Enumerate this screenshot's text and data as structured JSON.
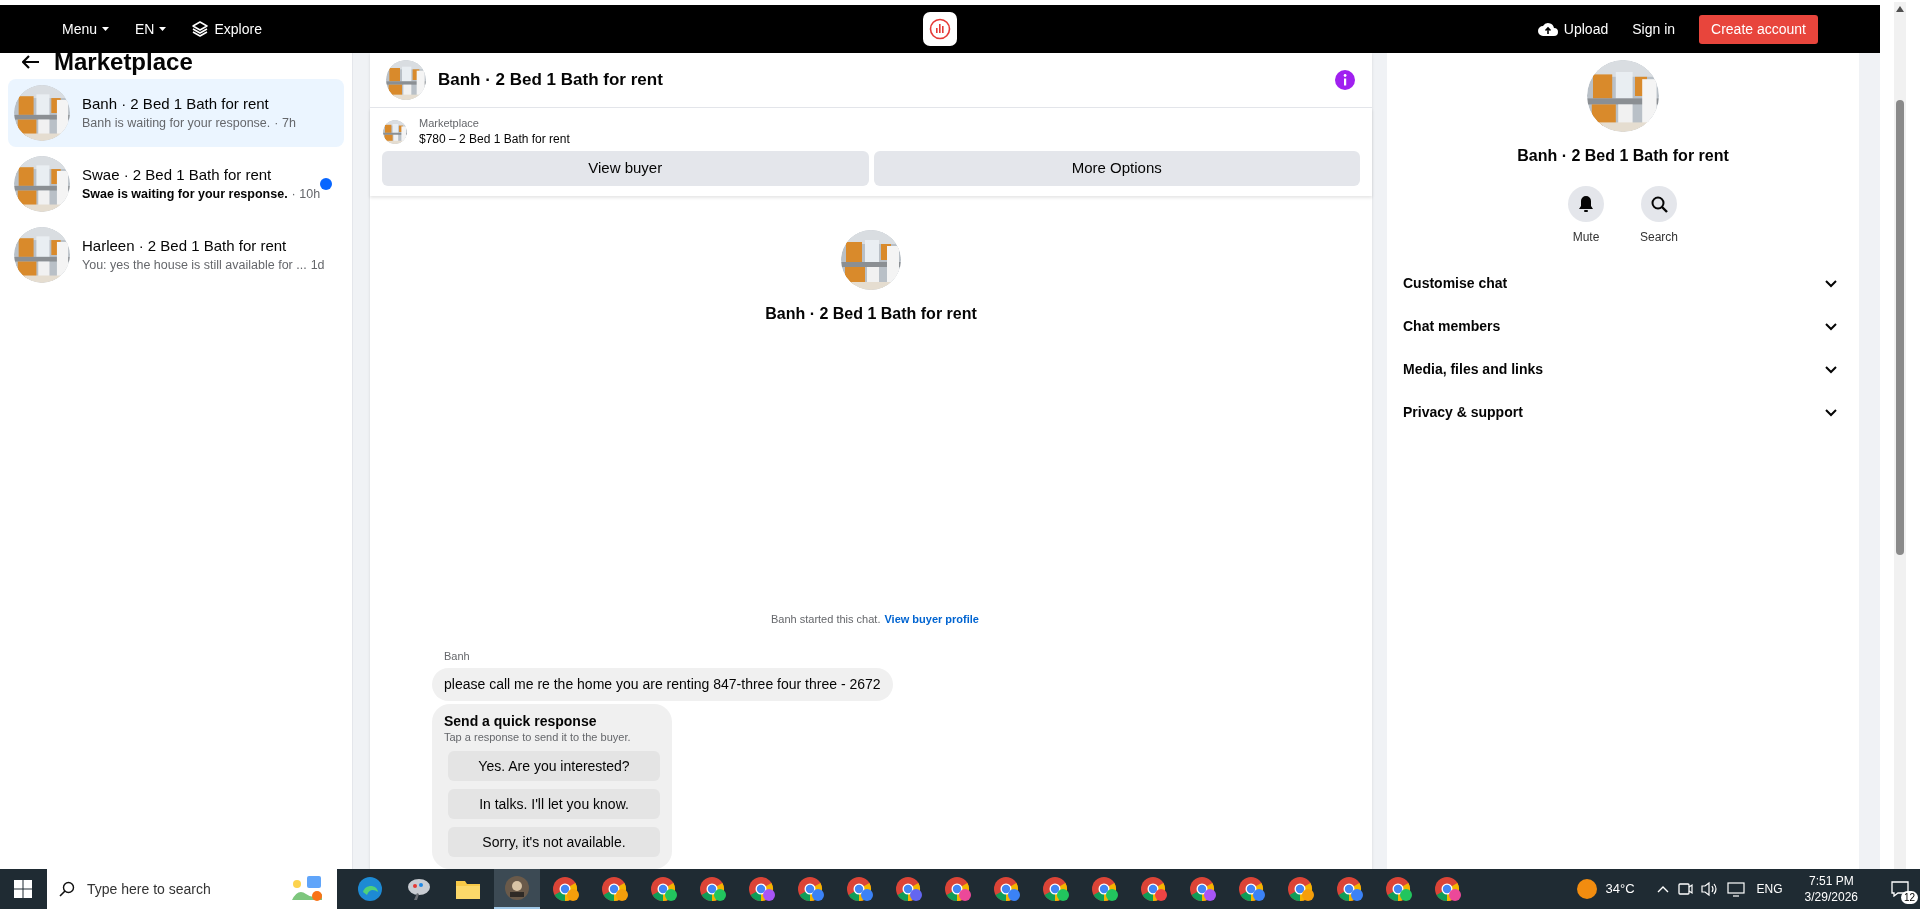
{
  "top_bar": {
    "menu": "Menu",
    "language": "EN",
    "explore": "Explore",
    "upload": "Upload",
    "sign_in": "Sign in",
    "create_account": "Create account"
  },
  "sidebar": {
    "title": "Marketplace",
    "conversations": [
      {
        "title": "Banh · 2 Bed 1 Bath for rent",
        "preview": "Banh is waiting for your response.",
        "time": "· 7h",
        "selected": true,
        "unread": false
      },
      {
        "title": "Swae · 2 Bed 1 Bath for rent",
        "preview": "Swae is waiting for your response.",
        "time": "· 10h",
        "selected": false,
        "unread": true
      },
      {
        "title": "Harleen · 2 Bed 1 Bath for rent",
        "preview": "You: yes the house is still available for ...",
        "time": "1d",
        "selected": false,
        "unread": false
      }
    ]
  },
  "chat": {
    "header_title": "Banh · 2 Bed 1 Bath for rent",
    "listing": {
      "label": "Marketplace",
      "title": "$780 – 2 Bed 1 Bath for rent"
    },
    "buttons": [
      "View buyer",
      "More Options"
    ],
    "intro_title": "Banh · 2 Bed 1 Bath for rent",
    "started_text": "Banh started this chat.",
    "started_link": "View buyer profile",
    "messages": [
      {
        "sender": "Banh",
        "text": "please call me re the home you are renting 847-three four three - 2672"
      }
    ],
    "quick_response": {
      "title": "Send a quick response",
      "subtitle": "Tap a response to send it to the buyer.",
      "options": [
        "Yes. Are you interested?",
        "In talks. I'll let you know.",
        "Sorry, it's not available."
      ]
    }
  },
  "details": {
    "title": "Banh · 2 Bed 1 Bath for rent",
    "actions": [
      {
        "kind": "mute",
        "label": "Mute"
      },
      {
        "kind": "search",
        "label": "Search"
      }
    ],
    "sections": [
      {
        "label": "Customise chat",
        "expanded": false
      },
      {
        "label": "Chat members",
        "expanded": false
      },
      {
        "label": "Media, files and links",
        "expanded": false
      },
      {
        "label": "Privacy & support",
        "expanded": false
      }
    ]
  },
  "taskbar": {
    "search_placeholder": "Type here to search",
    "apps": [
      {
        "kind": "edge"
      },
      {
        "kind": "tool"
      },
      {
        "kind": "folder"
      },
      {
        "kind": "app",
        "selected": true
      },
      {
        "kind": "chrome",
        "color": "#f59e0b"
      },
      {
        "kind": "chrome",
        "color": "#f59e0b"
      },
      {
        "kind": "chrome",
        "color": "#22c55e"
      },
      {
        "kind": "chrome",
        "color": "#22c55e"
      },
      {
        "kind": "chrome",
        "color": "#a855f7"
      },
      {
        "kind": "chrome",
        "color": "#3b82f6"
      },
      {
        "kind": "chrome",
        "color": "#3b82f6"
      },
      {
        "kind": "chrome",
        "color": "#6366f1"
      },
      {
        "kind": "chrome",
        "color": "#ec4899"
      },
      {
        "kind": "chrome",
        "color": "#3b82f6"
      },
      {
        "kind": "chrome",
        "color": "#22c55e"
      },
      {
        "kind": "chrome",
        "color": "#22c55e"
      },
      {
        "kind": "chrome",
        "color": "#ef4444"
      },
      {
        "kind": "chrome",
        "color": "#a855f7"
      },
      {
        "kind": "chrome",
        "color": "#3b82f6"
      },
      {
        "kind": "chrome",
        "color": "#f59e0b"
      },
      {
        "kind": "chrome",
        "color": "#3b82f6"
      },
      {
        "kind": "chrome",
        "color": "#22c55e"
      },
      {
        "kind": "chrome",
        "color": "#ec4899"
      }
    ],
    "weather": "34°C",
    "language": "ENG",
    "time": "7:51 PM",
    "date": "3/29/2026",
    "notifications": "12"
  }
}
